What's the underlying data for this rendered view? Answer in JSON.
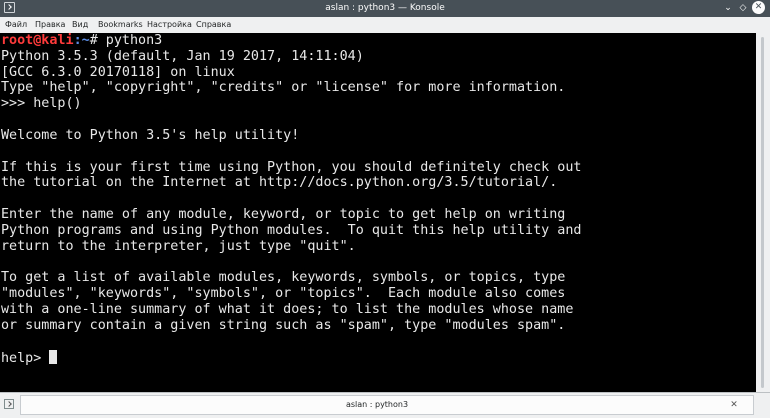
{
  "window": {
    "title": "aslan : python3 — Konsole",
    "minimize_glyph": "⌄",
    "maximize_glyph": "◇",
    "close_glyph": "✕",
    "icon": "terminal-icon"
  },
  "menu": {
    "items": [
      "Файл",
      "Правка",
      "Вид",
      "Bookmarks",
      "Настройка",
      "Справка"
    ]
  },
  "terminal": {
    "prompt_user": "root@kali",
    "prompt_path": ":~",
    "prompt_command": "# python3",
    "lines": [
      "Python 3.5.3 (default, Jan 19 2017, 14:11:04)",
      "[GCC 6.3.0 20170118] on linux",
      "Type \"help\", \"copyright\", \"credits\" or \"license\" for more information.",
      ">>> help()",
      "",
      "Welcome to Python 3.5's help utility!",
      "",
      "If this is your first time using Python, you should definitely check out",
      "the tutorial on the Internet at http://docs.python.org/3.5/tutorial/.",
      "",
      "Enter the name of any module, keyword, or topic to get help on writing",
      "Python programs and using Python modules.  To quit this help utility and",
      "return to the interpreter, just type \"quit\".",
      "",
      "To get a list of available modules, keywords, symbols, or topics, type",
      "\"modules\", \"keywords\", \"symbols\", or \"topics\".  Each module also comes",
      "with a one-line summary of what it does; to list the modules whose name",
      "or summary contain a given string such as \"spam\", type \"modules spam\".",
      ""
    ],
    "help_prompt": "help> "
  },
  "tabs": {
    "items": [
      {
        "label": "aslan : python3"
      }
    ],
    "close_glyph": "✕"
  }
}
